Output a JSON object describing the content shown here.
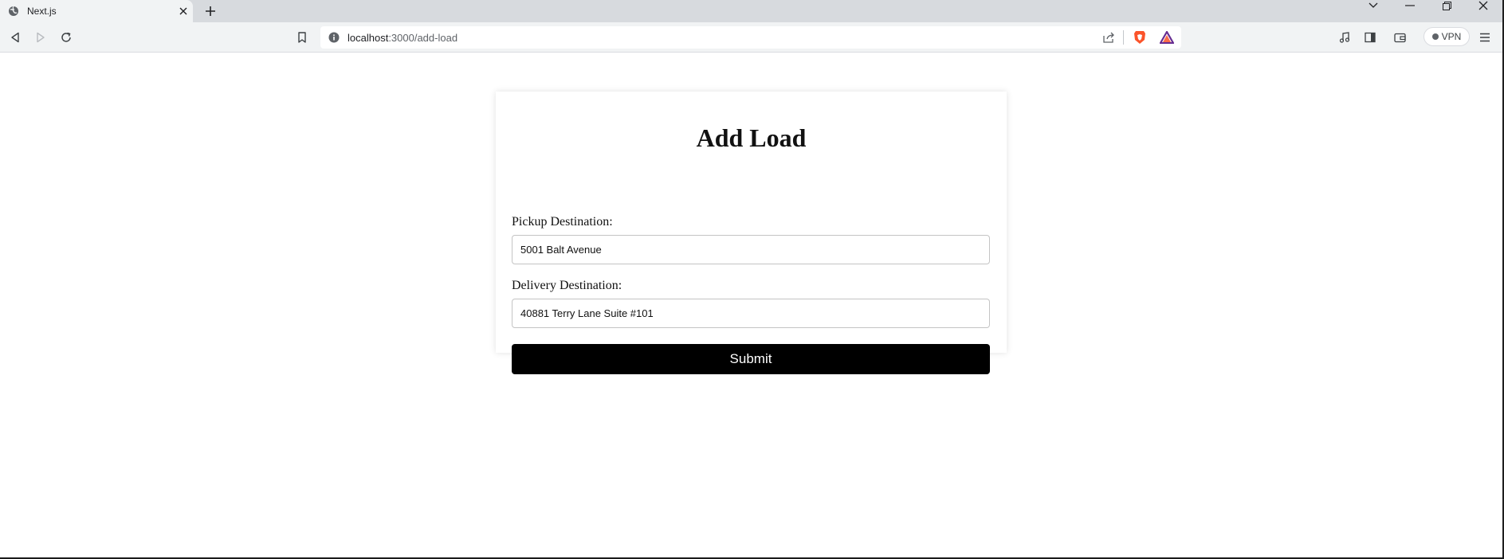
{
  "browser": {
    "tab": {
      "title": "Next.js",
      "favicon": "globe-icon"
    },
    "address_bar": {
      "host": "localhost",
      "path": ":3000/add-load"
    },
    "vpn_label": "VPN",
    "colors": {
      "brave_orange": "#fb542b",
      "tab_strip": "#d7dade"
    }
  },
  "form": {
    "title": "Add Load",
    "pickup": {
      "label": "Pickup Destination:",
      "value": "5001 Balt Avenue"
    },
    "delivery": {
      "label": "Delivery Destination:",
      "value": "40881 Terry Lane Suite #101"
    },
    "submit_label": "Submit"
  }
}
